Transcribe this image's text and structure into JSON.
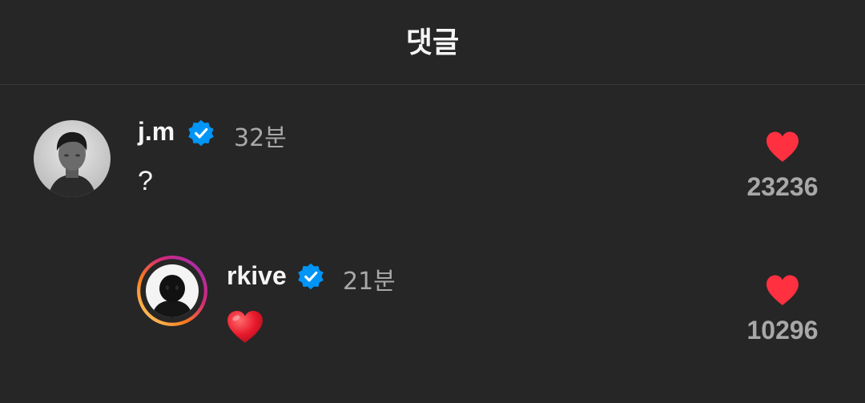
{
  "header": {
    "title": "댓글"
  },
  "comments": [
    {
      "username": "j.m",
      "verified": true,
      "time": "32분",
      "text": "?",
      "likes": "23236",
      "liked": true,
      "avatar_icon": "profile-photo-grayscale"
    },
    {
      "username": "rkive",
      "verified": true,
      "time": "21분",
      "text": "",
      "emoji": "red-heart",
      "likes": "10296",
      "liked": true,
      "story_ring": true,
      "avatar_icon": "profile-photo-dark"
    }
  ],
  "colors": {
    "background": "#262626",
    "verified": "#0095f6",
    "like": "#ff3040",
    "muted_text": "#a8a8a8"
  }
}
